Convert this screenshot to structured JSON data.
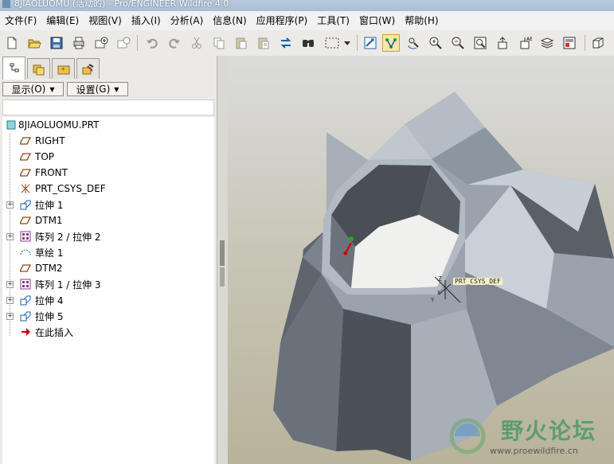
{
  "window": {
    "title": "8JIAOLUOMU (活动的) - Pro/ENGINEER Wildfire 4.0"
  },
  "menu": [
    {
      "label": "文件(F)"
    },
    {
      "label": "编辑(E)"
    },
    {
      "label": "视图(V)"
    },
    {
      "label": "插入(I)"
    },
    {
      "label": "分析(A)"
    },
    {
      "label": "信息(N)"
    },
    {
      "label": "应用程序(P)"
    },
    {
      "label": "工具(T)"
    },
    {
      "label": "窗口(W)"
    },
    {
      "label": "帮助(H)"
    }
  ],
  "toolbar": {
    "icons": [
      "new-icon",
      "open-icon",
      "save-icon",
      "print-icon",
      "email-icon",
      "email-link-icon",
      "undo-icon",
      "redo-icon",
      "cut-icon",
      "copy-icon",
      "paste-icon",
      "paste-special-icon",
      "regenerate-icon",
      "find-icon",
      "select-box-icon",
      "dropdown-arrow-icon",
      "model-tree-view-icon",
      "datum-display-icon",
      "spin-center-icon",
      "zoom-in-icon",
      "zoom-out-icon",
      "refit-icon",
      "reorient-icon",
      "saved-views-icon",
      "layers-icon",
      "display-style-icon"
    ]
  },
  "left_panel": {
    "show_button": "显示",
    "show_key": "(O)",
    "settings_button": "设置",
    "settings_key": "(G)",
    "tree": [
      {
        "label": "8JIAOLUOMU.PRT",
        "icon": "part-icon"
      },
      {
        "label": "RIGHT",
        "icon": "datum-plane-icon"
      },
      {
        "label": "TOP",
        "icon": "datum-plane-icon"
      },
      {
        "label": "FRONT",
        "icon": "datum-plane-icon"
      },
      {
        "label": "PRT_CSYS_DEF",
        "icon": "csys-icon"
      },
      {
        "label": "拉伸 1",
        "icon": "extrude-icon",
        "expandable": true
      },
      {
        "label": "DTM1",
        "icon": "datum-plane-icon"
      },
      {
        "label": "阵列 2 / 拉伸 2",
        "icon": "pattern-icon",
        "expandable": true
      },
      {
        "label": "草绘 1",
        "icon": "sketch-icon"
      },
      {
        "label": "DTM2",
        "icon": "datum-plane-icon"
      },
      {
        "label": "阵列 1 / 拉伸 3",
        "icon": "pattern-icon",
        "expandable": true
      },
      {
        "label": "拉伸 4",
        "icon": "extrude-icon",
        "expandable": true
      },
      {
        "label": "拉伸 5",
        "icon": "extrude-icon",
        "expandable": true
      },
      {
        "label": "在此插入",
        "icon": "insert-here-arrow-icon"
      }
    ]
  },
  "viewport": {
    "csys_label": "PRT_CSYS_DEF",
    "csys_x": "X",
    "csys_y": "Y",
    "csys_z": "Z",
    "watermark_text": "野火论坛",
    "watermark_url": "www.proewildfire.cn"
  },
  "colors": {
    "background_top": "#dcdcdc",
    "background_bottom": "#b8b39a",
    "model_face": "#9aa3ad",
    "highlight": "#fbe7a8"
  }
}
